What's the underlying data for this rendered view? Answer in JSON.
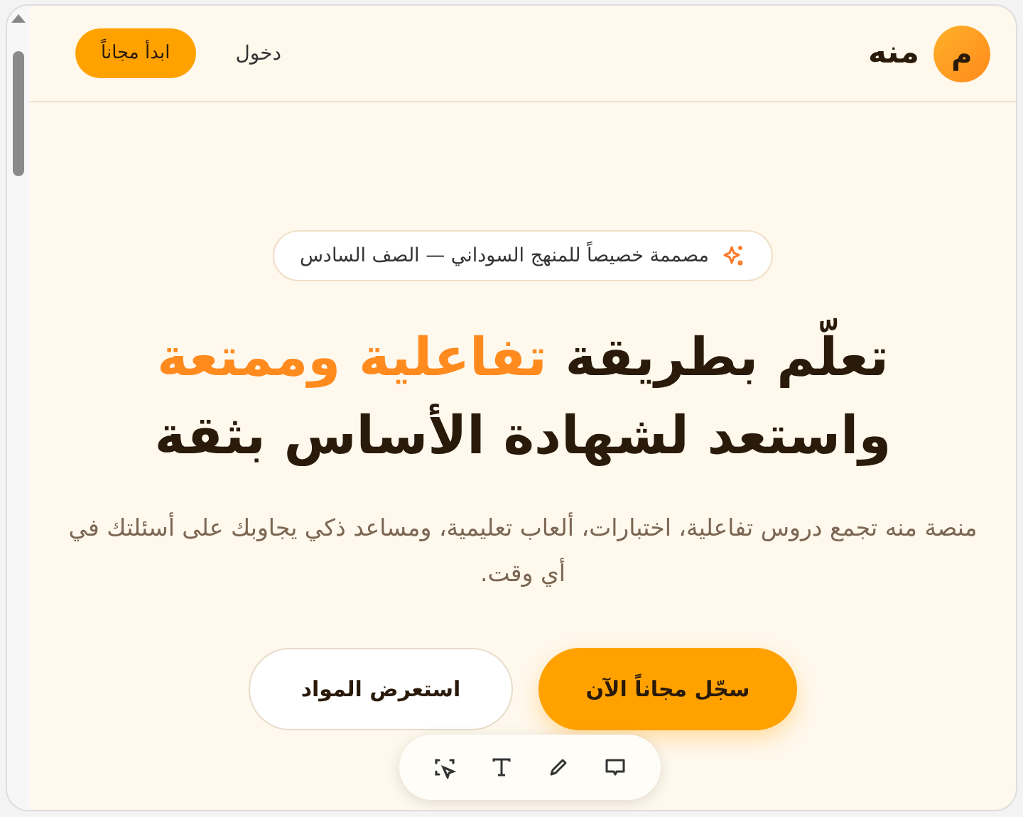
{
  "header": {
    "logo_letter": "م",
    "brand": "منه",
    "login": "دخول",
    "cta": "ابدأ مجاناً"
  },
  "hero": {
    "badge": "مصممة خصيصاً للمنهج السوداني — الصف السادس",
    "headline": {
      "before": "تعلّم بطريقة",
      "highlight": "تفاعلية وممتعة",
      "after": "واستعد لشهادة الأساس بثقة"
    },
    "description": "منصة منه تجمع دروس تفاعلية، اختبارات، ألعاب تعليمية، ومساعد ذكي يجاوبك على أسئلتك في أي وقت.",
    "buttons": [
      {
        "label": "سجّل مجاناً الآن",
        "kind": "primary"
      },
      {
        "label": "استعرض المواد",
        "kind": "secondary"
      }
    ]
  },
  "toolbar": [
    {
      "kind": "select"
    },
    {
      "kind": "text"
    },
    {
      "kind": "pen"
    },
    {
      "kind": "comment"
    }
  ]
}
